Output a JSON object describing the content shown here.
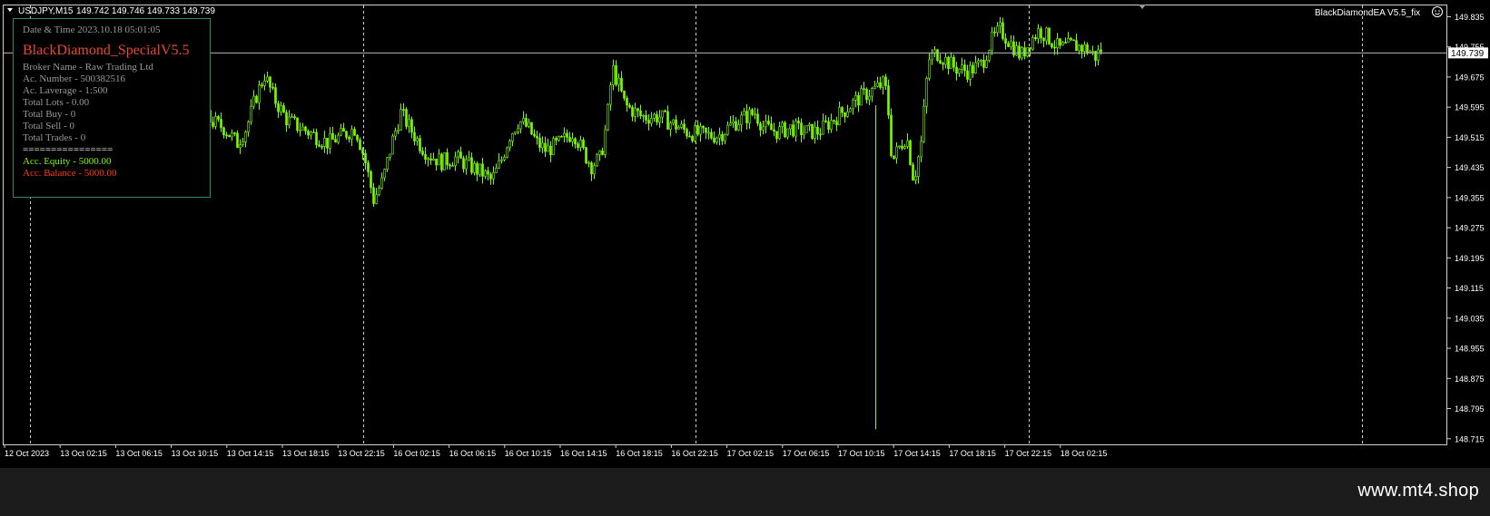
{
  "chart_header": {
    "symbol_timeframe": "USDJPY,M15",
    "ohlc": "149.742 149.746 149.733 149.739"
  },
  "ea_label": "BlackDiamondEA  V5.5_fix",
  "ea_icon": "smiley-icon",
  "info_panel": {
    "datetime": "Date & Time 2023.10.18 05:01:05",
    "title": "BlackDiamond_SpecialV5.5",
    "broker": "Broker Name - Raw Trading Ltd",
    "account": "Ac. Number - 500382516",
    "leverage": "Ac. Laverage - 1:500",
    "lots": "Total Lots - 0.00",
    "buy": "Total Buy - 0",
    "sell": "Total Sell - 0",
    "trades": "Total Trades - 0",
    "separator": "================",
    "equity": "Acc. Equity - 5000.00",
    "balance": "Acc. Balance - 5000.00"
  },
  "watermark": "www.mt4.shop",
  "colors": {
    "background": "#000000",
    "candle": "#7cfc00",
    "grid": "#d0d0d0",
    "panel_border": "#2e8b57",
    "panel_title": "#e64a2e",
    "equity": "#7cfc00",
    "balance": "#ff3b1f"
  },
  "chart_data": {
    "type": "candlestick",
    "symbol": "USDJPY",
    "timeframe": "M15",
    "current_price": 149.739,
    "price_axis_labels": [
      "149.835",
      "149.755",
      "149.675",
      "149.595",
      "149.515",
      "149.435",
      "149.355",
      "149.275",
      "149.195",
      "149.115",
      "149.035",
      "148.955",
      "148.875",
      "148.795",
      "148.715"
    ],
    "ylim": [
      148.7,
      149.865
    ],
    "time_axis_labels": [
      "12 Oct 2023",
      "13 Oct 02:15",
      "13 Oct 06:15",
      "13 Oct 10:15",
      "13 Oct 14:15",
      "13 Oct 18:15",
      "13 Oct 22:15",
      "16 Oct 02:15",
      "16 Oct 06:15",
      "16 Oct 10:15",
      "16 Oct 14:15",
      "16 Oct 18:15",
      "16 Oct 22:15",
      "17 Oct 02:15",
      "17 Oct 06:15",
      "17 Oct 10:15",
      "17 Oct 14:15",
      "17 Oct 18:15",
      "17 Oct 22:15",
      "18 Oct 02:15"
    ],
    "day_separators": [
      "13 Oct 2023",
      "16 Oct 2023",
      "17 Oct 2023",
      "18 Oct 2023",
      "18 Oct 2023 end"
    ],
    "price_path": [
      [
        0,
        149.74
      ],
      [
        40,
        149.72
      ],
      [
        60,
        149.72
      ],
      [
        70,
        149.7
      ],
      [
        90,
        149.66
      ],
      [
        110,
        149.62
      ],
      [
        125,
        149.58
      ],
      [
        140,
        149.55
      ],
      [
        150,
        149.58
      ],
      [
        165,
        149.62
      ],
      [
        175,
        149.66
      ],
      [
        185,
        149.63
      ],
      [
        200,
        149.59
      ],
      [
        215,
        149.56
      ],
      [
        230,
        149.54
      ],
      [
        245,
        149.5
      ],
      [
        255,
        149.54
      ],
      [
        265,
        149.62
      ],
      [
        275,
        149.68
      ],
      [
        285,
        149.62
      ],
      [
        300,
        149.56
      ],
      [
        315,
        149.54
      ],
      [
        330,
        149.52
      ],
      [
        345,
        149.5
      ],
      [
        360,
        149.52
      ],
      [
        375,
        149.54
      ],
      [
        385,
        149.46
      ],
      [
        395,
        149.35
      ],
      [
        405,
        149.4
      ],
      [
        415,
        149.5
      ],
      [
        425,
        149.58
      ],
      [
        435,
        149.54
      ],
      [
        445,
        149.5
      ],
      [
        455,
        149.47
      ],
      [
        470,
        149.45
      ],
      [
        485,
        149.46
      ],
      [
        500,
        149.44
      ],
      [
        515,
        149.42
      ],
      [
        525,
        149.4
      ],
      [
        535,
        149.45
      ],
      [
        545,
        149.52
      ],
      [
        555,
        149.56
      ],
      [
        565,
        149.54
      ],
      [
        575,
        149.5
      ],
      [
        585,
        149.48
      ],
      [
        600,
        149.5
      ],
      [
        615,
        149.53
      ],
      [
        625,
        149.48
      ],
      [
        635,
        149.44
      ],
      [
        645,
        149.46
      ],
      [
        652,
        149.56
      ],
      [
        658,
        149.7
      ],
      [
        664,
        149.66
      ],
      [
        672,
        149.6
      ],
      [
        690,
        149.57
      ],
      [
        710,
        149.57
      ],
      [
        725,
        149.55
      ],
      [
        740,
        149.53
      ],
      [
        760,
        149.52
      ],
      [
        775,
        149.52
      ],
      [
        790,
        149.55
      ],
      [
        805,
        149.57
      ],
      [
        815,
        149.58
      ],
      [
        825,
        149.54
      ],
      [
        840,
        149.53
      ],
      [
        855,
        149.54
      ],
      [
        870,
        149.53
      ],
      [
        885,
        149.53
      ],
      [
        900,
        149.56
      ],
      [
        915,
        149.59
      ],
      [
        930,
        149.62
      ],
      [
        945,
        149.64
      ],
      [
        958,
        149.66
      ],
      [
        962,
        149.58
      ],
      [
        966,
        149.45
      ],
      [
        972,
        149.48
      ],
      [
        982,
        149.52
      ],
      [
        990,
        149.4
      ],
      [
        998,
        149.5
      ],
      [
        1006,
        149.72
      ],
      [
        1015,
        149.74
      ],
      [
        1025,
        149.72
      ],
      [
        1035,
        149.7
      ],
      [
        1050,
        149.69
      ],
      [
        1065,
        149.71
      ],
      [
        1075,
        149.77
      ],
      [
        1085,
        149.8
      ],
      [
        1095,
        149.77
      ],
      [
        1108,
        149.73
      ],
      [
        1118,
        149.77
      ],
      [
        1128,
        149.8
      ],
      [
        1138,
        149.78
      ],
      [
        1150,
        149.75
      ],
      [
        1165,
        149.76
      ],
      [
        1180,
        149.75
      ],
      [
        1190,
        149.73
      ],
      [
        1200,
        149.76
      ],
      [
        1212,
        149.74
      ]
    ],
    "spike_low": {
      "x": 964,
      "price": 148.74
    }
  }
}
